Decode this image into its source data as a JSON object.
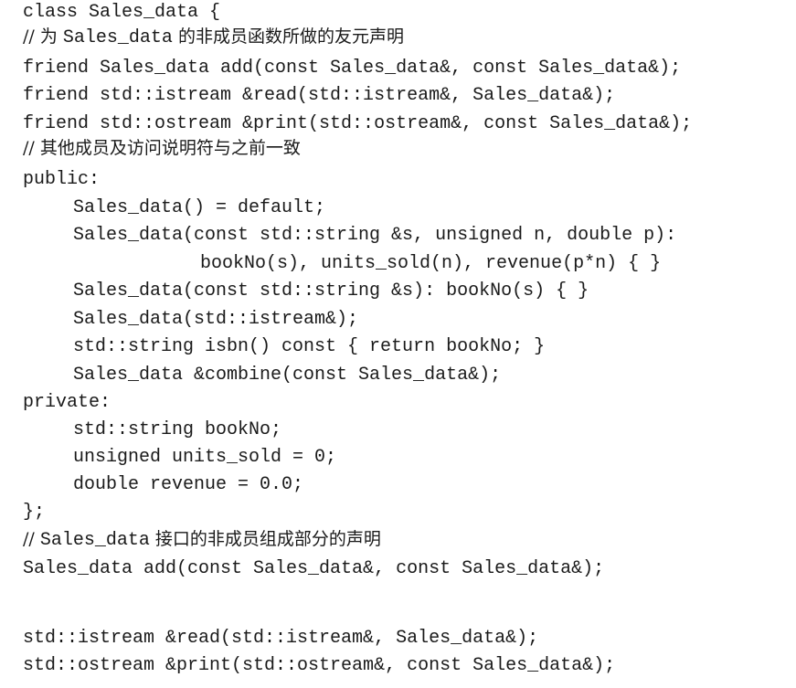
{
  "code": {
    "class_open": "class Sales_data {",
    "comment_friend_prefix": "// 为 ",
    "comment_friend_mono": "Sales_data",
    "comment_friend_suffix": " 的非成员函数所做的友元声明",
    "friend_add": "friend Sales_data add(const Sales_data&, const Sales_data&);",
    "friend_read": "friend std::istream &read(std::istream&, Sales_data&);",
    "friend_print": "friend std::ostream &print(std::ostream&, const Sales_data&);",
    "comment_other": "// 其他成员及访问说明符与之前一致",
    "public_label": "public:",
    "ctor_default": "Sales_data() = default;",
    "ctor_full": "Sales_data(const std::string &s, unsigned n, double p):",
    "ctor_full_init": "bookNo(s), units_sold(n), revenue(p*n) { }",
    "ctor_string": "Sales_data(const std::string &s): bookNo(s) { }",
    "ctor_istream": "Sales_data(std::istream&);",
    "isbn_fn": "std::string isbn() const { return bookNo; }",
    "combine_fn": "Sales_data &combine(const Sales_data&);",
    "private_label": "private:",
    "member_bookno": "std::string bookNo;",
    "member_units": "unsigned units_sold = 0;",
    "member_revenue": "double revenue = 0.0;",
    "class_close": "};",
    "comment_iface_prefix": "// ",
    "comment_iface_mono": "Sales_data",
    "comment_iface_suffix": " 接口的非成员组成部分的声明",
    "decl_add": "Sales_data add(const Sales_data&, const Sales_data&);",
    "decl_read": "std::istream &read(std::istream&, Sales_data&);",
    "decl_print": "std::ostream &print(std::ostream&, const Sales_data&);"
  }
}
